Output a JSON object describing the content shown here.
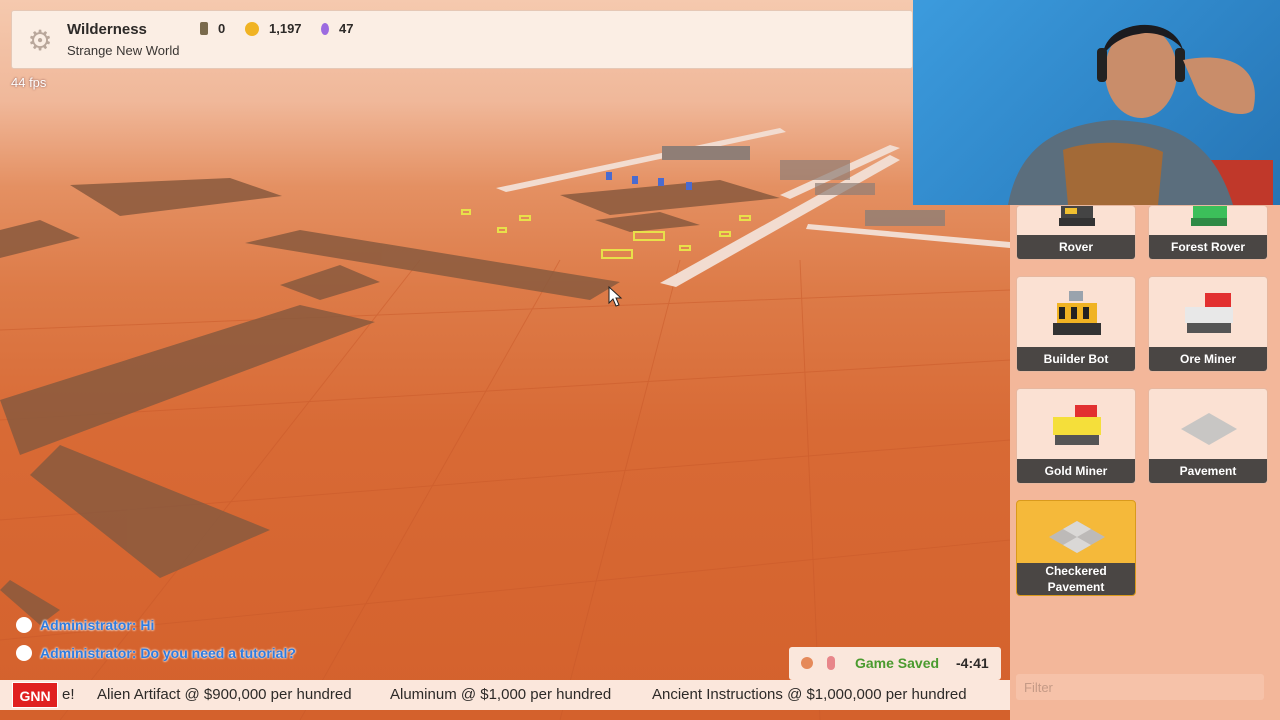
{
  "hud": {
    "title": "Wilderness",
    "subtitle": "Strange New World",
    "resources": [
      {
        "icon": "worker-icon",
        "value": "0",
        "color": "#7a6a4c"
      },
      {
        "icon": "coin-icon",
        "value": "1,197",
        "color": "#f0b323"
      },
      {
        "icon": "potion-icon",
        "value": "47",
        "color": "#9c6be0"
      }
    ]
  },
  "fps": "44 fps",
  "panel": {
    "cards": [
      {
        "label": "Rover",
        "selected": false
      },
      {
        "label": "Forest Rover",
        "selected": false
      },
      {
        "label": "Builder Bot",
        "selected": false
      },
      {
        "label": "Ore Miner",
        "selected": false
      },
      {
        "label": "Gold Miner",
        "selected": false
      },
      {
        "label": "Pavement",
        "selected": false
      },
      {
        "label": "Checkered Pavement",
        "selected": true
      }
    ],
    "filter_placeholder": "Filter"
  },
  "chat": [
    {
      "text": "Administrator: Hi"
    },
    {
      "text": "Administrator: Do you need a tutorial?"
    }
  ],
  "toast": {
    "text": "Game Saved",
    "time": "-4:41"
  },
  "ticker": {
    "badge": "GNN",
    "items": [
      "e!",
      "Alien Artifact @ $900,000 per hundred",
      "Aluminum @ $1,000 per hundred",
      "Ancient Instructions @ $1,000,000 per hundred"
    ]
  },
  "colors": {
    "ground": "#d8642e",
    "panel": "#f3b79a",
    "accent_selected": "#f5b93a",
    "chat": "#2f7ce0",
    "saved": "#4a9b2f"
  }
}
